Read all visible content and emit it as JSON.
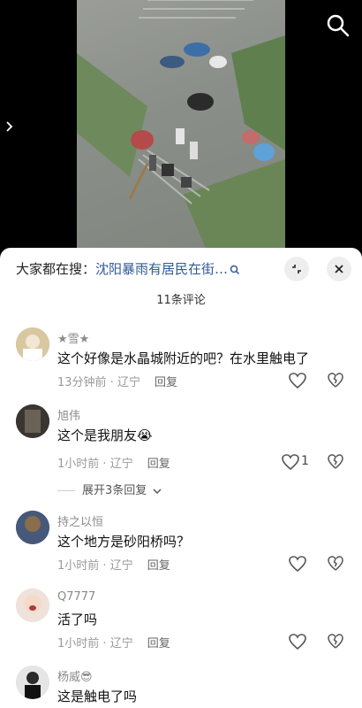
{
  "video": {
    "search_icon": "search-icon",
    "side_arrow_icon": "chevron-right-icon"
  },
  "sheet": {
    "search_hint": "大家都在搜：",
    "search_query": "沈阳暴雨有居民在街…",
    "comment_count": "11条评论",
    "collapse_icon": "collapse-icon",
    "close_icon": "close-icon"
  },
  "comments": [
    {
      "name": "★雪★",
      "text": "这个好像是水晶城附近的吧？在水里触电了",
      "time": "13分钟前",
      "location": "辽宁",
      "reply": "回复",
      "likes": ""
    },
    {
      "name": "旭伟",
      "text": "这个是我朋友😭",
      "time": "1小时前",
      "location": "辽宁",
      "reply": "回复",
      "likes": "1",
      "expand": "展开3条回复"
    },
    {
      "name": "持之以恒",
      "text": "这个地方是砂阳桥吗？",
      "time": "1小时前",
      "location": "辽宁",
      "reply": "回复",
      "likes": ""
    },
    {
      "name": "Q7777",
      "text": "活了吗",
      "time": "1小时前",
      "location": "辽宁",
      "reply": "回复",
      "likes": ""
    },
    {
      "name": "杨威😎",
      "text": "这是触电了吗",
      "time": "",
      "location": "",
      "reply": "",
      "likes": ""
    }
  ]
}
